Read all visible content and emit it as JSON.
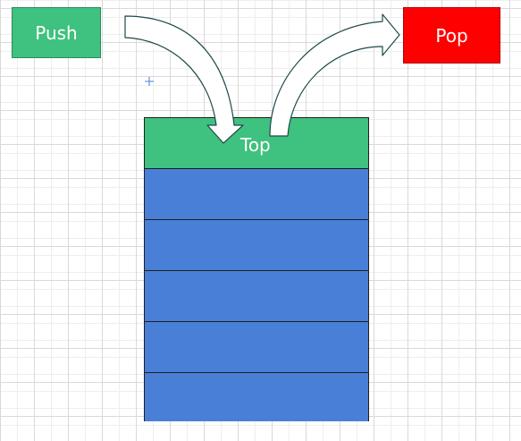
{
  "diagram": {
    "push_label": "Push",
    "pop_label": "Pop",
    "top_label": "Top",
    "stack_cells": [
      "",
      "",
      "",
      "",
      ""
    ]
  },
  "colors": {
    "push_fill": "#3fc17f",
    "pop_fill": "#ff0000",
    "top_fill": "#3fc17f",
    "stack_fill": "#4a7fd7",
    "arrow_fill": "#ffffff",
    "arrow_stroke": "#1f4a4a"
  },
  "icons": {
    "push_arrow": "curved-arrow-down-icon",
    "pop_arrow": "curved-arrow-up-right-icon",
    "cursor": "crosshair-icon"
  }
}
